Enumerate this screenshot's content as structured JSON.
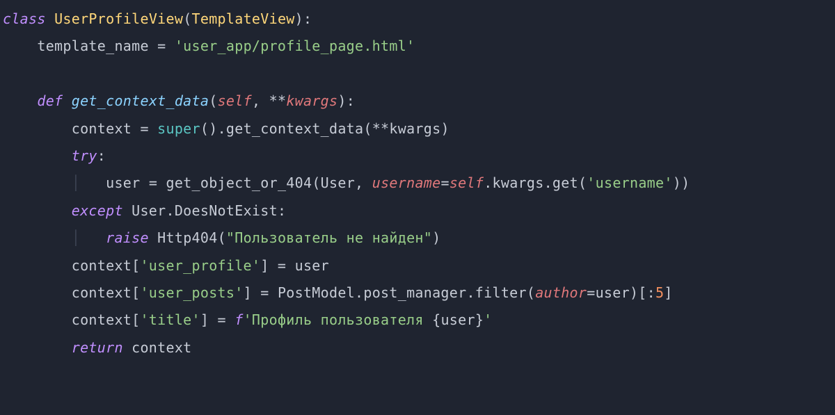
{
  "code": {
    "l1": {
      "kw_class": "class",
      "cls": "UserProfileView",
      "po": "(",
      "base": "TemplateView",
      "pc": "):"
    },
    "l2": {
      "indent": "    ",
      "var": "template_name",
      "eq": " = ",
      "str": "'user_app/profile_page.html'"
    },
    "l3": {
      "blank": ""
    },
    "l4": {
      "indent": "    ",
      "kw_def": "def",
      "fn": "get_context_data",
      "po": "(",
      "self": "self",
      "comma": ", ",
      "stars": "**",
      "kwargs": "kwargs",
      "pc": "):"
    },
    "l5": {
      "indent": "        ",
      "var": "context",
      "eq": " = ",
      "super": "super",
      "par": "()",
      "dot": ".",
      "fn": "get_context_data",
      "po": "(",
      "stars": "**",
      "kwargs": "kwargs",
      "pc": ")"
    },
    "l6": {
      "indent": "        ",
      "kw_try": "try",
      "colon": ":"
    },
    "l7": {
      "indent": "            ",
      "var": "user",
      "eq": " = ",
      "fn": "get_object_or_404",
      "po": "(",
      "cls": "User",
      "comma": ", ",
      "arg": "username",
      "eq2": "=",
      "self": "self",
      "dot": ".",
      "kwargs": "kwargs",
      "dot2": ".",
      "get": "get",
      "po2": "(",
      "str": "'username'",
      "pc2": ")",
      "pc": ")"
    },
    "l8": {
      "indent": "        ",
      "kw_except": "except",
      "sp": " ",
      "cls": "User",
      "dot": ".",
      "exc": "DoesNotExist",
      "colon": ":"
    },
    "l9": {
      "indent": "            ",
      "kw_raise": "raise",
      "sp": " ",
      "cls": "Http404",
      "po": "(",
      "str": "\"Пользователь не найден\"",
      "pc": ")"
    },
    "l10": {
      "indent": "        ",
      "var": "context",
      "po": "[",
      "str": "'user_profile'",
      "pc": "]",
      "eq": " = ",
      "val": "user"
    },
    "l11": {
      "indent": "        ",
      "var": "context",
      "po": "[",
      "str": "'user_posts'",
      "pc": "]",
      "eq": " = ",
      "cls": "PostModel",
      "dot": ".",
      "mgr": "post_manager",
      "dot2": ".",
      "fn": "filter",
      "po2": "(",
      "arg": "author",
      "eq2": "=",
      "val": "user",
      "pc2": ")",
      "slice_o": "[",
      "slice_c": ":",
      "num": "5",
      "slice_e": "]"
    },
    "l12": {
      "indent": "        ",
      "var": "context",
      "po": "[",
      "str": "'title'",
      "pc": "]",
      "eq": " = ",
      "fpre": "f",
      "str2": "'Профиль пользователя ",
      "bo": "{",
      "val": "user",
      "bc": "}",
      "sq": "'"
    },
    "l13": {
      "indent": "        ",
      "kw_return": "return",
      "sp": " ",
      "var": "context"
    }
  }
}
